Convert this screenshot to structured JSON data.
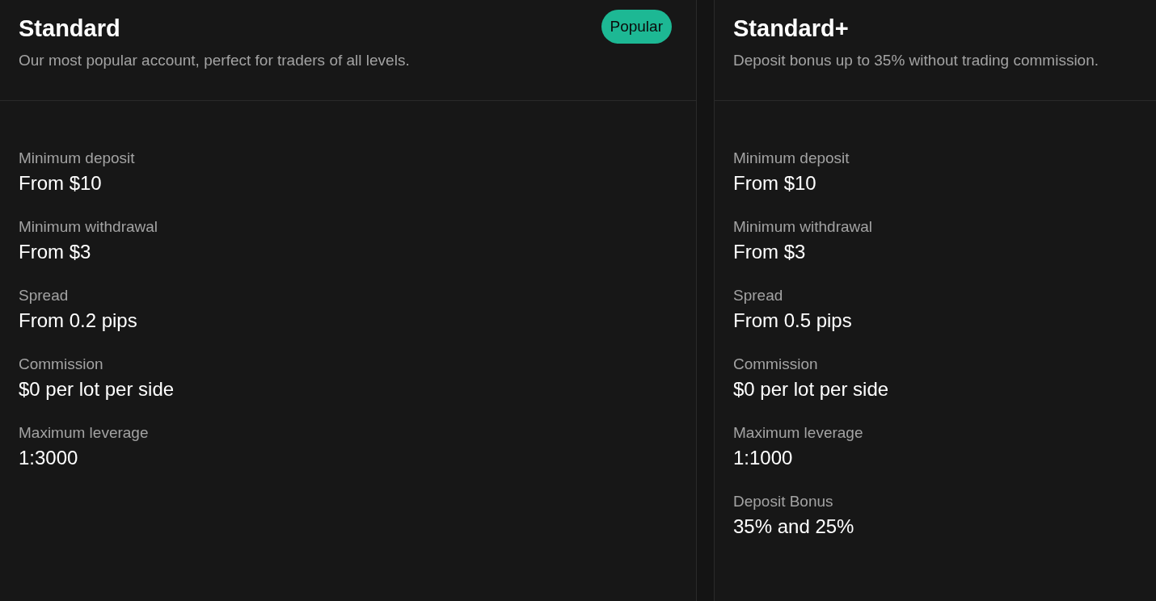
{
  "accounts": [
    {
      "title": "Standard",
      "badge": "Popular",
      "description": "Our most popular account, perfect for traders of all levels.",
      "specs": [
        {
          "label": "Minimum deposit",
          "value": "From $10"
        },
        {
          "label": "Minimum withdrawal",
          "value": "From $3"
        },
        {
          "label": "Spread",
          "value": "From 0.2 pips"
        },
        {
          "label": "Commission",
          "value": "$0 per lot per side"
        },
        {
          "label": "Maximum leverage",
          "value": "1:3000"
        }
      ]
    },
    {
      "title": "Standard+",
      "description": "Deposit bonus up to 35% without trading commission.",
      "specs": [
        {
          "label": "Minimum deposit",
          "value": "From $10"
        },
        {
          "label": "Minimum withdrawal",
          "value": "From $3"
        },
        {
          "label": "Spread",
          "value": "From 0.5 pips"
        },
        {
          "label": "Commission",
          "value": "$0 per lot per side"
        },
        {
          "label": "Maximum leverage",
          "value": "1:1000"
        },
        {
          "label": "Deposit Bonus",
          "value": "35% and 25%"
        }
      ]
    }
  ]
}
